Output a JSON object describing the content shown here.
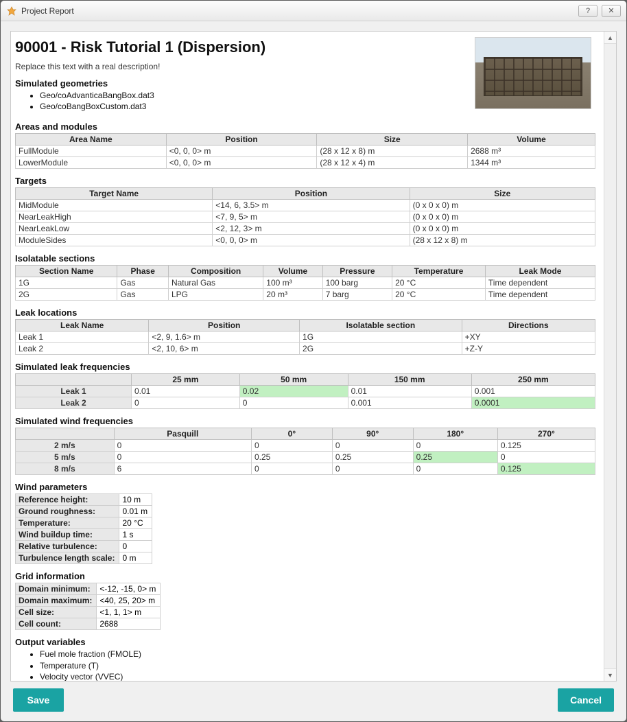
{
  "window": {
    "title": "Project Report",
    "help": "?",
    "close": "✕"
  },
  "report": {
    "title": "90001 - Risk Tutorial 1 (Dispersion)",
    "description": "Replace this text with a real description!",
    "sections": {
      "simGeom": "Simulated geometries",
      "areas": "Areas and modules",
      "targets": "Targets",
      "iso": "Isolatable sections",
      "leakLoc": "Leak locations",
      "leakFreq": "Simulated leak frequencies",
      "windFreq": "Simulated wind frequencies",
      "windParams": "Wind parameters",
      "grid": "Grid information",
      "output": "Output variables"
    },
    "geomFiles": [
      "Geo/coAdvanticaBangBox.dat3",
      "Geo/coBangBoxCustom.dat3"
    ],
    "areas": {
      "headers": [
        "Area Name",
        "Position",
        "Size",
        "Volume"
      ],
      "rows": [
        [
          "FullModule",
          "<0, 0, 0> m",
          "(28 x 12 x 8) m",
          "2688 m³"
        ],
        [
          "LowerModule",
          "<0, 0, 0> m",
          "(28 x 12 x 4) m",
          "1344 m³"
        ]
      ]
    },
    "targets": {
      "headers": [
        "Target Name",
        "Position",
        "Size"
      ],
      "rows": [
        [
          "MidModule",
          "<14, 6, 3.5> m",
          "(0 x 0 x 0) m"
        ],
        [
          "NearLeakHigh",
          "<7, 9, 5> m",
          "(0 x 0 x 0) m"
        ],
        [
          "NearLeakLow",
          "<2, 12, 3> m",
          "(0 x 0 x 0) m"
        ],
        [
          "ModuleSides",
          "<0, 0, 0> m",
          "(28 x 12 x 8) m"
        ]
      ]
    },
    "iso": {
      "headers": [
        "Section Name",
        "Phase",
        "Composition",
        "Volume",
        "Pressure",
        "Temperature",
        "Leak Mode"
      ],
      "rows": [
        [
          "1G",
          "Gas",
          "Natural Gas",
          "100 m³",
          "100 barg",
          "20 °C",
          "Time dependent"
        ],
        [
          "2G",
          "Gas",
          "LPG",
          "20 m³",
          "7 barg",
          "20 °C",
          "Time dependent"
        ]
      ]
    },
    "leakLoc": {
      "headers": [
        "Leak Name",
        "Position",
        "Isolatable section",
        "Directions"
      ],
      "rows": [
        [
          "Leak 1",
          "<2, 9, 1.6> m",
          "1G",
          "+XY"
        ],
        [
          "Leak 2",
          "<2, 10, 6> m",
          "2G",
          "+Z-Y"
        ]
      ]
    },
    "leakFreq": {
      "headers": [
        "",
        "25 mm",
        "50 mm",
        "150 mm",
        "250 mm"
      ],
      "rows": [
        {
          "label": "Leak 1",
          "cells": [
            "0.01",
            "0.02",
            "0.01",
            "0.001"
          ],
          "hl": [
            1
          ]
        },
        {
          "label": "Leak 2",
          "cells": [
            "0",
            "0",
            "0.001",
            "0.0001"
          ],
          "hl": [
            3
          ]
        }
      ]
    },
    "windFreq": {
      "headers": [
        "",
        "Pasquill",
        "0°",
        "90°",
        "180°",
        "270°"
      ],
      "rows": [
        {
          "label": "2 m/s",
          "cells": [
            "0",
            "0",
            "0",
            "0",
            "0.125"
          ],
          "hl": []
        },
        {
          "label": "5 m/s",
          "cells": [
            "0",
            "0.25",
            "0.25",
            "0.25",
            "0"
          ],
          "hl": [
            3
          ]
        },
        {
          "label": "8 m/s",
          "cells": [
            "6",
            "0",
            "0",
            "0",
            "0.125"
          ],
          "hl": [
            4
          ]
        }
      ]
    },
    "windParams": [
      [
        "Reference height:",
        "10 m"
      ],
      [
        "Ground roughness:",
        "0.01 m"
      ],
      [
        "Temperature:",
        "20 °C"
      ],
      [
        "Wind buildup time:",
        "1 s"
      ],
      [
        "Relative turbulence:",
        "0"
      ],
      [
        "Turbulence length scale:",
        "0 m"
      ]
    ],
    "grid": [
      [
        "Domain minimum:",
        "<-12, -15, 0> m"
      ],
      [
        "Domain maximum:",
        "<40, 25, 20> m"
      ],
      [
        "Cell size:",
        "<1, 1, 1> m"
      ],
      [
        "Cell count:",
        "2688"
      ]
    ],
    "outputVars": [
      "Fuel mole fraction (FMOLE)",
      "Temperature (T)",
      "Velocity vector (VVEC)"
    ]
  },
  "buttons": {
    "save": "Save",
    "cancel": "Cancel"
  }
}
